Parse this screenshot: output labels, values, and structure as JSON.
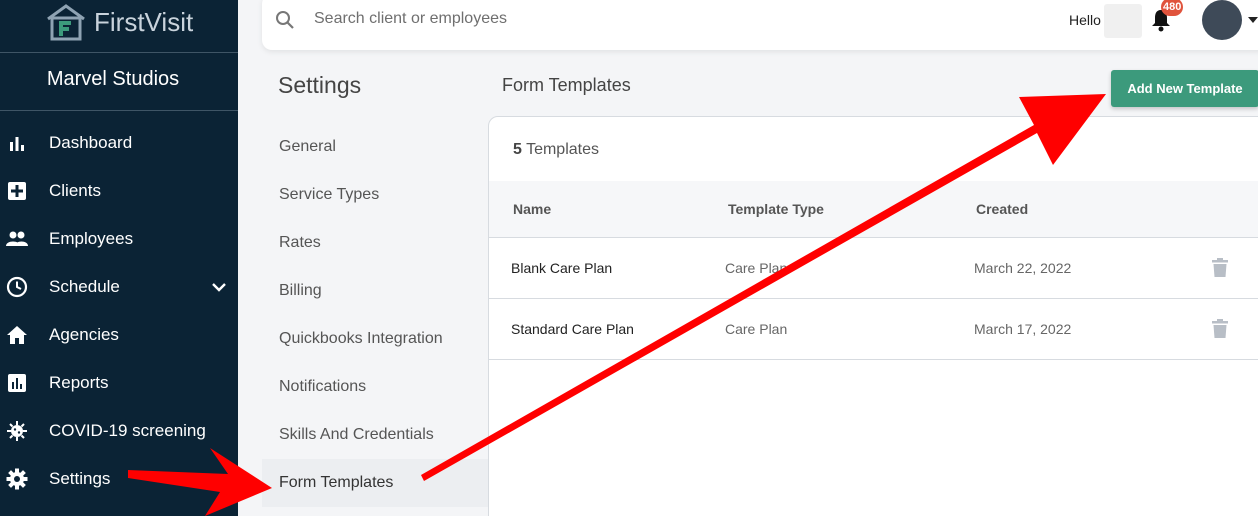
{
  "brand": {
    "name": "FirstVisit"
  },
  "organization": "Marvel Studios",
  "sidebar": {
    "items": [
      {
        "label": "Dashboard",
        "icon": "bar-chart-icon"
      },
      {
        "label": "Clients",
        "icon": "medical-plus-icon"
      },
      {
        "label": "Employees",
        "icon": "people-icon"
      },
      {
        "label": "Schedule",
        "icon": "clock-icon"
      },
      {
        "label": "Agencies",
        "icon": "home-icon"
      },
      {
        "label": "Reports",
        "icon": "report-icon"
      },
      {
        "label": "COVID-19 screening",
        "icon": "virus-icon"
      },
      {
        "label": "Settings",
        "icon": "gear-icon"
      }
    ]
  },
  "topbar": {
    "search_placeholder": "Search client or employees",
    "greeting": "Hello",
    "notification_count": "480"
  },
  "settings": {
    "title": "Settings",
    "items": [
      "General",
      "Service Types",
      "Rates",
      "Billing",
      "Quickbooks Integration",
      "Notifications",
      "Skills And Credentials",
      "Form Templates"
    ],
    "active": "Form Templates"
  },
  "main": {
    "title": "Form Templates",
    "add_button": "Add New Template",
    "count_number": "5",
    "count_label": "Templates",
    "columns": [
      "Name",
      "Template Type",
      "Created"
    ],
    "rows": [
      {
        "name": "Blank Care Plan",
        "type": "Care Plan",
        "created": "March 22, 2022"
      },
      {
        "name": "Standard Care Plan",
        "type": "Care Plan",
        "created": "March 17, 2022"
      }
    ]
  },
  "colors": {
    "sidebar_bg": "#0b2335",
    "accent_button": "#3c9a7c",
    "badge": "#e0533c",
    "annotation_arrow": "#ff0000"
  }
}
